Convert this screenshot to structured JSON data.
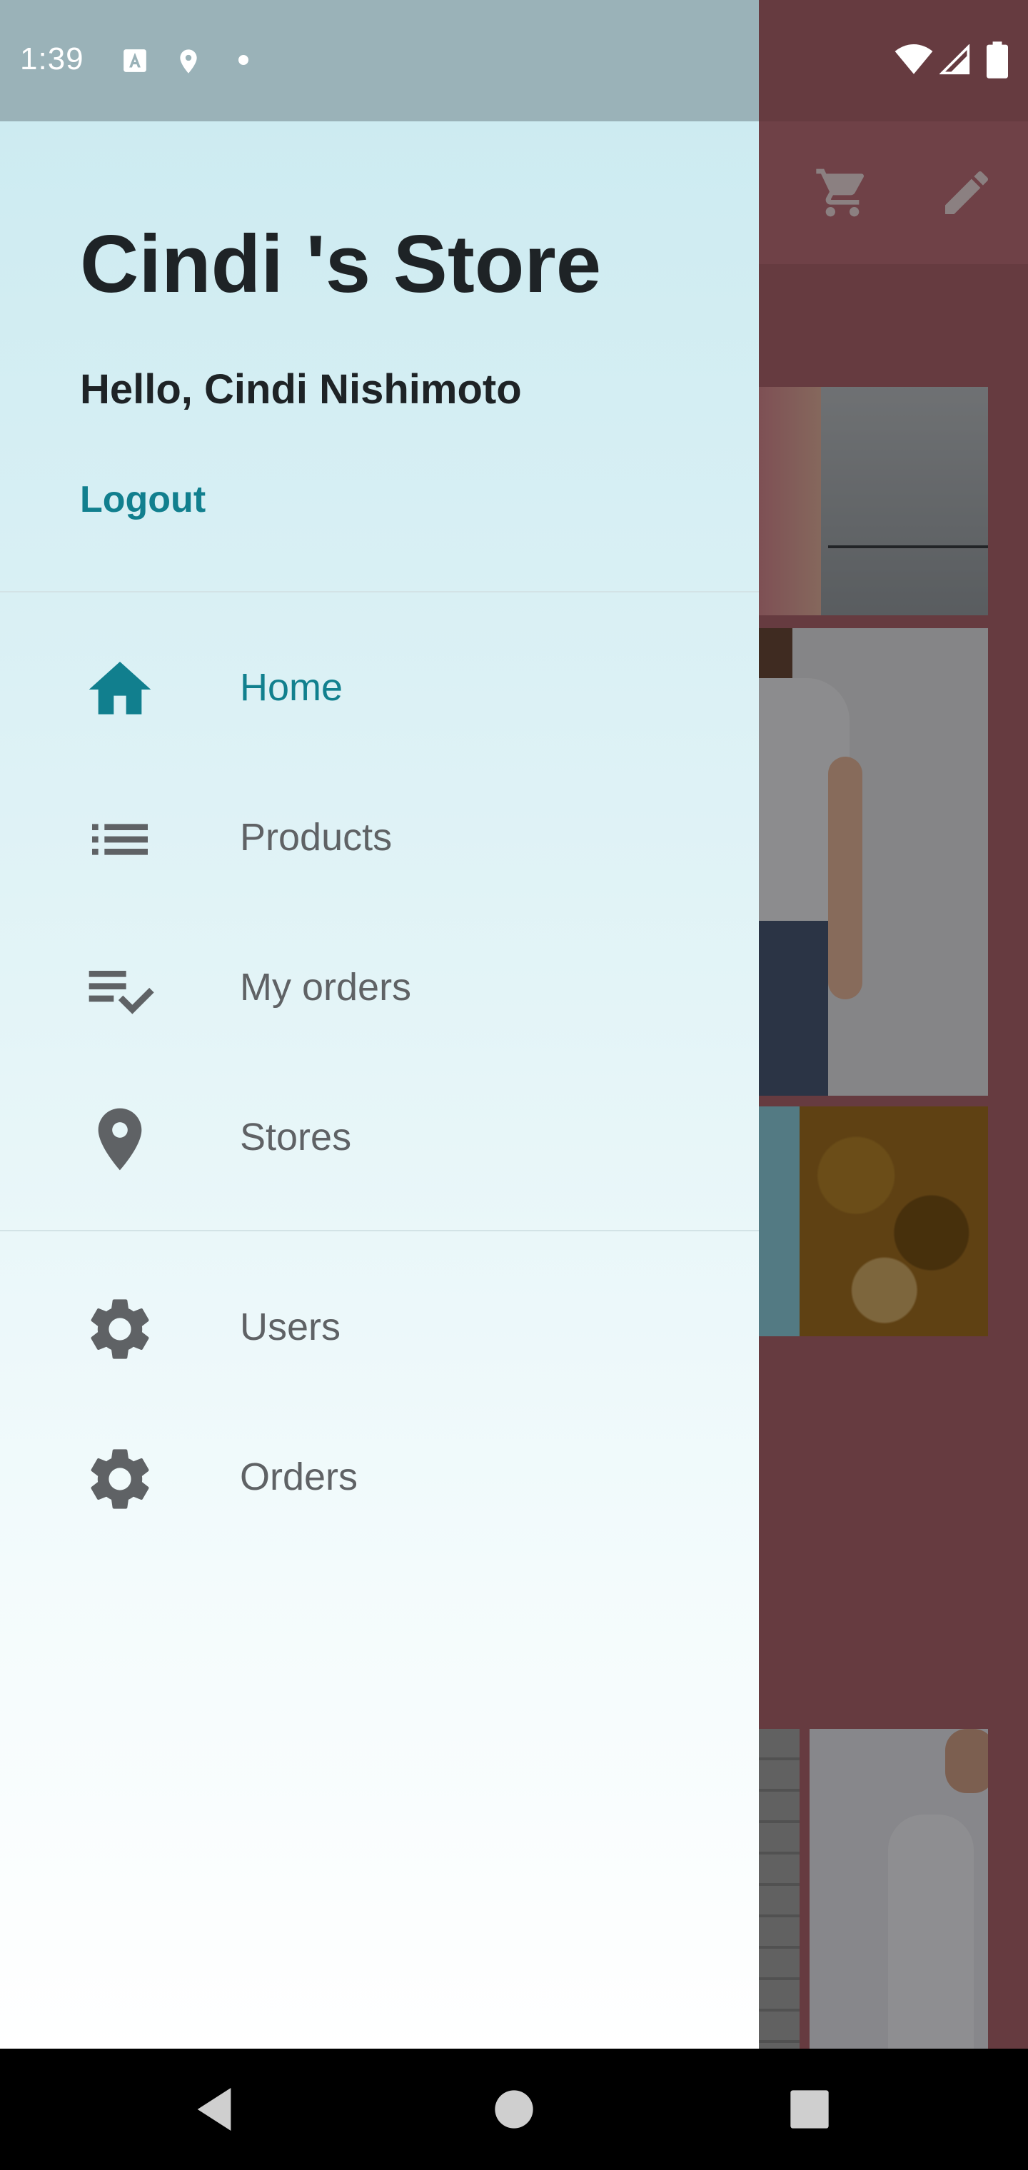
{
  "status_bar": {
    "time": "1:39",
    "left_icons": [
      "a-badge-icon",
      "location-icon",
      "dot-icon"
    ],
    "right_icons": [
      "wifi-icon",
      "signal-icon",
      "battery-icon"
    ]
  },
  "drawer": {
    "store_title": "Cindi 's Store",
    "greeting": "Hello, Cindi Nishimoto",
    "logout_label": "Logout",
    "main_items": [
      {
        "label": "Home",
        "icon": "home-icon",
        "active": true
      },
      {
        "label": "Products",
        "icon": "list-icon",
        "active": false
      },
      {
        "label": "My orders",
        "icon": "playlist-check-icon",
        "active": false
      },
      {
        "label": "Stores",
        "icon": "location-pin-icon",
        "active": false
      }
    ],
    "admin_items": [
      {
        "label": "Users",
        "icon": "gear-icon"
      },
      {
        "label": "Orders",
        "icon": "gear-icon"
      }
    ]
  },
  "background_toolbar": {
    "icons": [
      "cart-icon",
      "edit-icon"
    ]
  },
  "system_nav": {
    "buttons": [
      "back-button",
      "home-button",
      "recents-button"
    ]
  },
  "colors": {
    "accent": "#117f8e",
    "text_primary": "#1e2326",
    "text_secondary": "#5f6265",
    "icon_inactive": "#5f6265",
    "background_app": "#b0666f"
  }
}
